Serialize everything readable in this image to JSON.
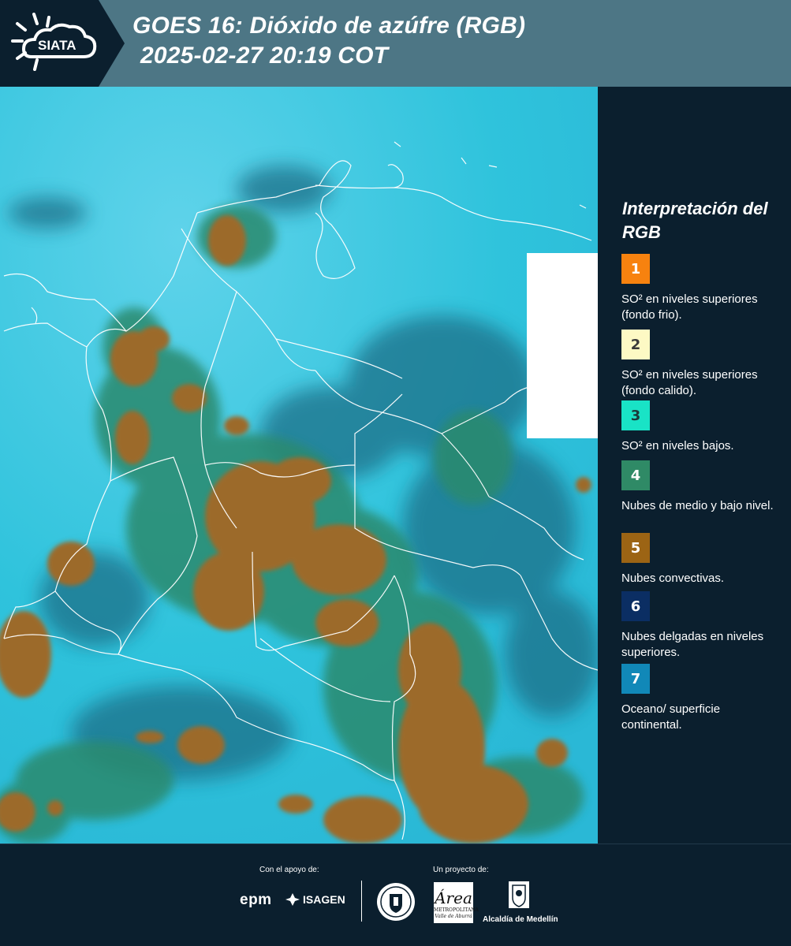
{
  "header": {
    "logo_text": "SIATA",
    "title_line1": "GOES 16: Dióxido de azúfre (RGB)",
    "title_line2": "2025-02-27 20:19 COT",
    "bg_color": "#4d7685",
    "chevron_color": "#0b1f2e"
  },
  "legend": {
    "title": "Interpretación del RGB",
    "items": [
      {
        "number": "1",
        "color": "#f7820f",
        "number_color": "#ffffff",
        "text": "SO² en niveles superiores (fondo frio)."
      },
      {
        "number": "2",
        "color": "#fdf9c4",
        "number_color": "#3a3a3a",
        "text": "SO² en niveles superiores (fondo calido)."
      },
      {
        "number": "3",
        "color": "#19e3c6",
        "number_color": "#1a3a3a",
        "text": "SO² en niveles bajos."
      },
      {
        "number": "4",
        "color": "#2f8a66",
        "number_color": "#ffffff",
        "text": "Nubes de medio y bajo nivel."
      },
      {
        "number": "5",
        "color": "#9c6414",
        "number_color": "#ffffff",
        "text": "Nubes convectivas."
      },
      {
        "number": "6",
        "color": "#0b2e63",
        "number_color": "#ffffff",
        "text": "Nubes delgadas en niveles superiores."
      },
      {
        "number": "7",
        "color": "#1188b8",
        "number_color": "#ffffff",
        "text": "Oceano/ superficie continental."
      }
    ]
  },
  "map": {
    "ocean_color": "#2fc3dc",
    "convective_color": "#9c6a2a",
    "midlevel_color": "#2c8a6e",
    "thin_color": "#1d5f7a",
    "border_color": "#ffffff"
  },
  "footer": {
    "support_label": "Con el apoyo de:",
    "project_label": "Un proyecto de:",
    "epm": "epm",
    "isagen": "ISAGEN",
    "area_name": "Área",
    "area_sub1": "METROPOLITANA",
    "area_sub2": "Valle de Aburrá",
    "alcaldia": "Alcaldía de Medellín"
  }
}
